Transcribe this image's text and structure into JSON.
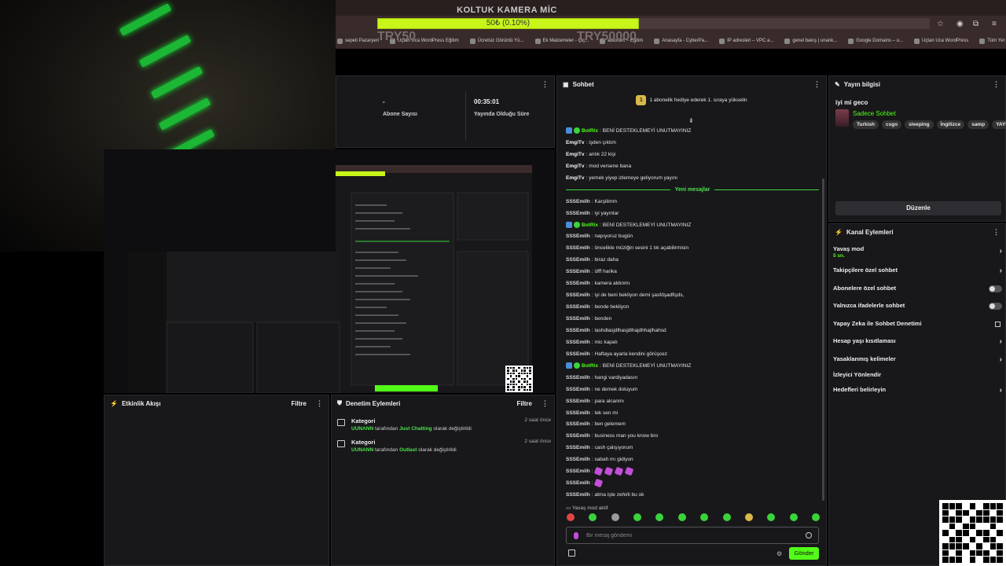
{
  "overlay": {
    "title": "KOLTUK KAMERA MİC",
    "progress_text": "50₺ (0.10%)",
    "progress_fraction": 0.001,
    "goal_left": "TRY50",
    "goal_right": "TRY50000"
  },
  "bookmarks": [
    "sepeti Pazaryeri",
    "Uçtan Uca WordPress Eğitim",
    "Ücretsiz Görüntü Yü...",
    "Ek Malzemeler - Çiç...",
    "autocert ~ Eğitim",
    "Anasayfa - CyberPa...",
    "IP adresleri – VPC a...",
    "genel bakış | unank...",
    "Google Domains – u...",
    "Uçtan Uca WordPress",
    "Tüm Yer İşaretleri"
  ],
  "stats": {
    "subs_value": "-",
    "subs_label": "Abone Sayısı",
    "time_value": "00:35:01",
    "time_label": "Yayında Olduğu Süre"
  },
  "activity": {
    "title": "Etkinlik Akışı",
    "filter": "Filtre"
  },
  "mod_actions": {
    "title": "Denetim Eylemleri",
    "filter": "Filtre",
    "items": [
      {
        "category": "Kategori",
        "user": "UUNANN",
        "text1": " tarafından ",
        "value": "Just Chatting",
        "text2": " olarak değiştirildi",
        "time": "2 saat önce"
      },
      {
        "category": "Kategori",
        "user": "UUNANN",
        "text1": " tarafından ",
        "value": "Outlast",
        "text2": " olarak değiştirildi",
        "time": "2 saat önce"
      }
    ]
  },
  "chat": {
    "title": "Sohbet",
    "gift_banner": "1 abonelik hediye ederek 1. sıraya yükselin",
    "gift_count": "1",
    "new_messages": "Yeni mesajlar",
    "slow_mode_note": "Yavaş mod aktif",
    "placeholder": "Bir mesaj gönderin",
    "send": "Gönder",
    "messages": [
      {
        "user": "BotRix",
        "type": "bot",
        "text": "BENİ DESTEKLEMEYİ UNUTMAYINIZ"
      },
      {
        "user": "EmgiTv",
        "type": "emg",
        "text": "işden çıktım"
      },
      {
        "user": "EmgiTv",
        "type": "emg",
        "text": "anlık 22 kişi"
      },
      {
        "user": "EmgiTv",
        "type": "emg",
        "text": "mod versene bana"
      },
      {
        "user": "EmgiTv",
        "type": "emg",
        "text": "yemek yiyep izlemeye geliyorum yayını"
      },
      {
        "type": "divider"
      },
      {
        "user": "SSSEmilh",
        "type": "sss",
        "text": "Karşilimm"
      },
      {
        "user": "SSSEmilh",
        "type": "sss",
        "text": "iyi yayınlar"
      },
      {
        "user": "BotRix",
        "type": "bot",
        "text": "BENİ DESTEKLEMEYİ UNUTMAYINIZ"
      },
      {
        "user": "SSSEmilh",
        "type": "sss",
        "text": "napıyoruz bugün"
      },
      {
        "user": "SSSEmilh",
        "type": "sss",
        "text": "öncelikle müziğin sesini 1 tık açabilirmisin"
      },
      {
        "user": "SSSEmilh",
        "type": "sss",
        "text": "biraz daha"
      },
      {
        "user": "SSSEmilh",
        "type": "sss",
        "text": "üfff harika"
      },
      {
        "user": "SSSEmilh",
        "type": "sss",
        "text": "kamera aldınmı"
      },
      {
        "user": "SSSEmilh",
        "type": "sss",
        "text": "iyi de beni bekliyon demi şasfdşadfişds,"
      },
      {
        "user": "SSSEmilh",
        "type": "sss",
        "text": "bende bekliyon"
      },
      {
        "user": "SSSEmilh",
        "type": "sss",
        "text": "benden"
      },
      {
        "user": "SSSEmilh",
        "type": "sss",
        "text": "lashdlasjdlhasjdlhajdhhajlhahsd"
      },
      {
        "user": "SSSEmilh",
        "type": "sss",
        "text": "mic kapalı"
      },
      {
        "user": "SSSEmilh",
        "type": "sss",
        "text": "Haftaya ayarla kendini görüşcez"
      },
      {
        "user": "BotRix",
        "type": "bot",
        "text": "BENİ DESTEKLEMEYİ UNUTMAYINIZ"
      },
      {
        "user": "SSSEmilh",
        "type": "sss",
        "text": "hangi vardiyadasın"
      },
      {
        "user": "SSSEmilh",
        "type": "sss",
        "text": "ne demek doluyum"
      },
      {
        "user": "SSSEmilh",
        "type": "sss",
        "text": "para alcanmı"
      },
      {
        "user": "SSSEmilh",
        "type": "sss",
        "text": "tek sen mi"
      },
      {
        "user": "SSSEmilh",
        "type": "sss",
        "text": "ben gelemem"
      },
      {
        "user": "SSSEmilh",
        "type": "sss",
        "text": "business man you know bro"
      },
      {
        "user": "SSSEmilh",
        "type": "sss",
        "text": "cash çalışıyorum"
      },
      {
        "user": "SSSEmilh",
        "type": "sss",
        "text": "sabah mı gidiyon"
      },
      {
        "user": "SSSEmilh",
        "type": "sss",
        "text": "",
        "emotes": 4
      },
      {
        "user": "SSSEmilh",
        "type": "sss",
        "text": "",
        "emotes": 1
      },
      {
        "user": "SSSEmilh",
        "type": "sss",
        "text": "atma işte zehirli bu ok"
      }
    ]
  },
  "stream_info": {
    "title_label": "Yayın bilgisi",
    "stream_title": "iyi mi geco",
    "category": "Sadece Sohbet",
    "tags": [
      "Turkish",
      "csgo",
      "sleeping",
      "İngilizce",
      "samp",
      "YAYIN"
    ],
    "edit": "Düzenle"
  },
  "channel_actions": {
    "title": "Kanal Eylemleri",
    "slow_mode": "Yavaş mod",
    "slow_mode_value": "5 sn.",
    "followers_only": "Takipçilere özel sohbet",
    "subs_only": "Abonelere özel sohbet",
    "emotes_only": "Yalnızca ifadelerle sohbet",
    "ai_moderation": "Yapay Zeka ile Sohbet Denetimi",
    "account_age": "Hesap yaşı kısıtlaması",
    "banned_words": "Yasaklanmış kelimeler",
    "viewer_redirect": "İzleyici Yönlendir",
    "set_goals": "Hedefleri belirleyin"
  },
  "colors": {
    "accent": "#53fc18",
    "progress": "#c8f51a",
    "panel": "#18181b"
  }
}
